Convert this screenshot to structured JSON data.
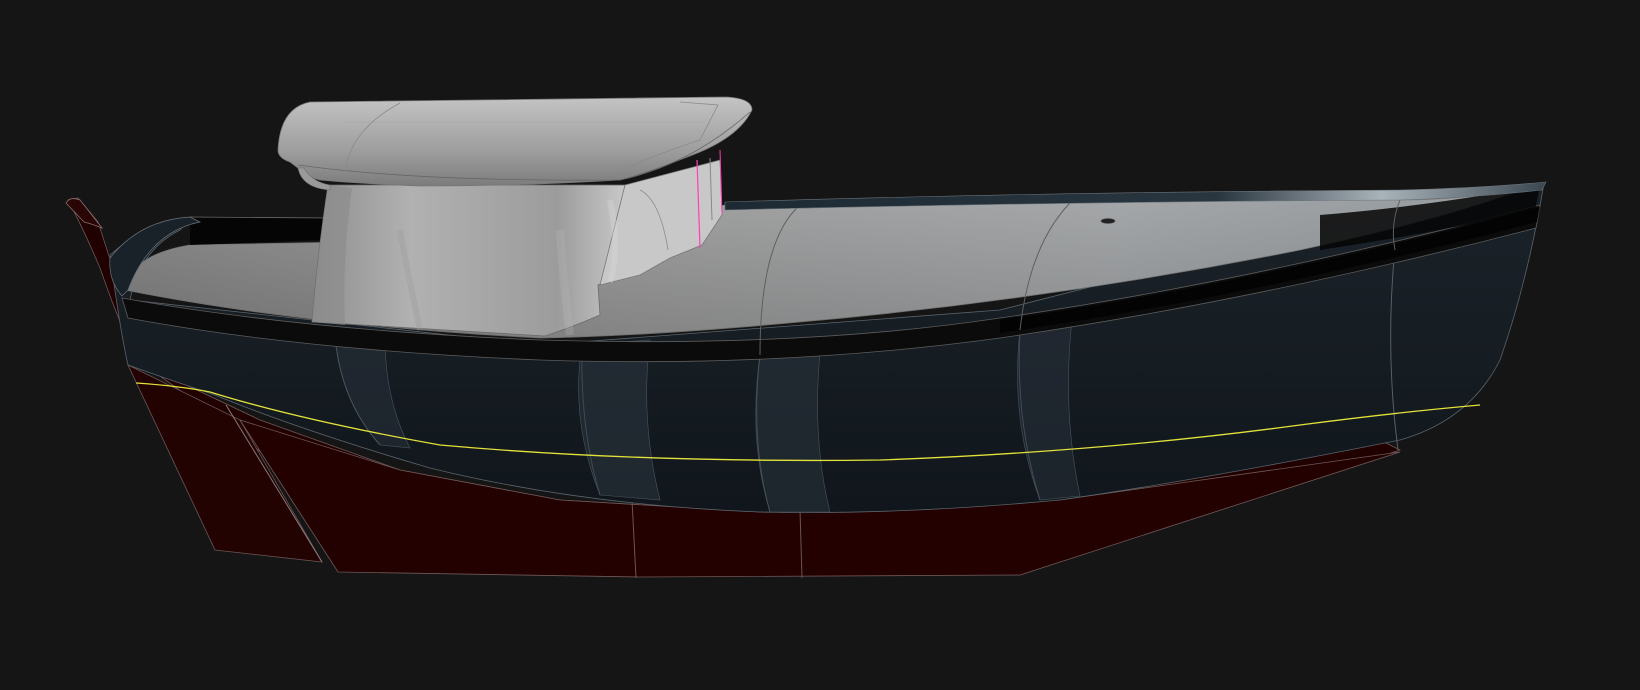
{
  "viewport": {
    "background": "#151515",
    "content": "3d-boat-hull-render"
  },
  "colors": {
    "underbody": "#210000",
    "topsides": "#151c22",
    "sheer_band": "#0a0a0a",
    "deck": "#8e8e8e",
    "cabin": "#a9a9a9",
    "cabin_roof": "#b4b4b4",
    "waterline": "#e2e23a",
    "edge_lines": "#6f6f6f",
    "highlight_pink": "#ff3fb4"
  }
}
